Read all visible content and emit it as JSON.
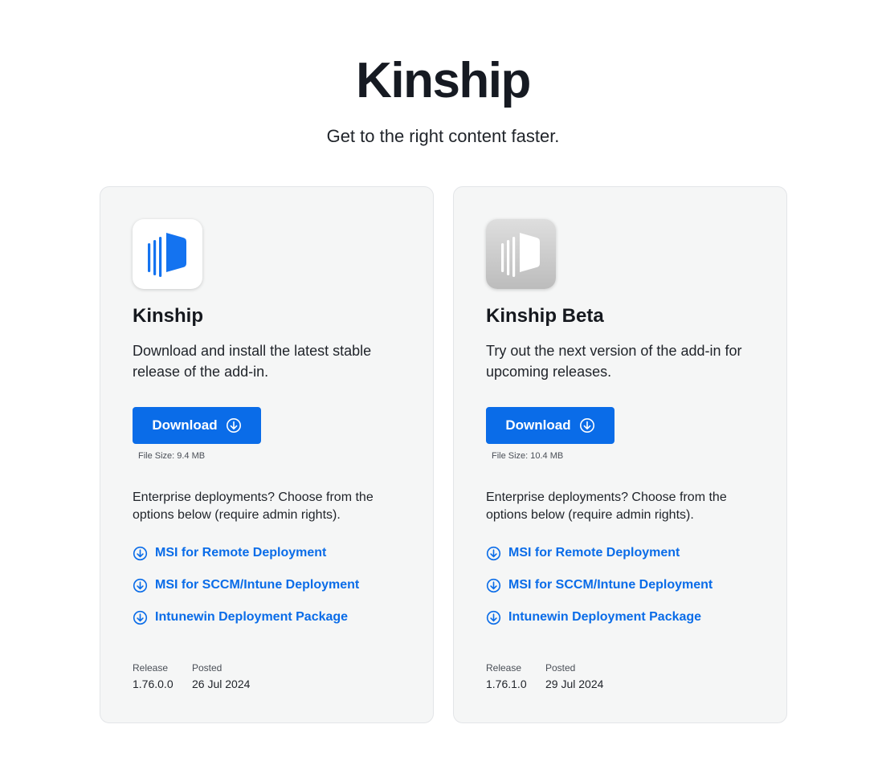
{
  "hero": {
    "title": "Kinship",
    "subtitle": "Get to the right content faster."
  },
  "colors": {
    "accent": "#0a6ce8",
    "card_background": "#f5f6f6",
    "card_border": "#e3e5e8",
    "text_dark": "#16191f"
  },
  "cards": [
    {
      "icon": "kinship-app-icon",
      "title": "Kinship",
      "description": "Download and install the latest stable release of the add-in.",
      "download_label": "Download",
      "download_icon": "download-circle-icon",
      "file_size_label": "File Size:",
      "file_size_value": "9.4 MB",
      "enterprise_note": "Enterprise deployments? Choose from the options below (require admin rights).",
      "links": [
        {
          "label": "MSI for Remote Deployment",
          "icon": "download-circle-icon"
        },
        {
          "label": "MSI for SCCM/Intune Deployment",
          "icon": "download-circle-icon"
        },
        {
          "label": "Intunewin Deployment Package",
          "icon": "download-circle-icon"
        }
      ],
      "release_label": "Release",
      "release_value": "1.76.0.0",
      "posted_label": "Posted",
      "posted_value": "26 Jul 2024"
    },
    {
      "icon": "kinship-beta-app-icon",
      "title": "Kinship Beta",
      "description": "Try out the next version of the add-in for upcoming releases.",
      "download_label": "Download",
      "download_icon": "download-circle-icon",
      "file_size_label": "File Size:",
      "file_size_value": "10.4 MB",
      "enterprise_note": "Enterprise deployments? Choose from the options below (require admin rights).",
      "links": [
        {
          "label": "MSI for Remote Deployment",
          "icon": "download-circle-icon"
        },
        {
          "label": "MSI for SCCM/Intune Deployment",
          "icon": "download-circle-icon"
        },
        {
          "label": "Intunewin Deployment Package",
          "icon": "download-circle-icon"
        }
      ],
      "release_label": "Release",
      "release_value": "1.76.1.0",
      "posted_label": "Posted",
      "posted_value": "29 Jul 2024"
    }
  ]
}
